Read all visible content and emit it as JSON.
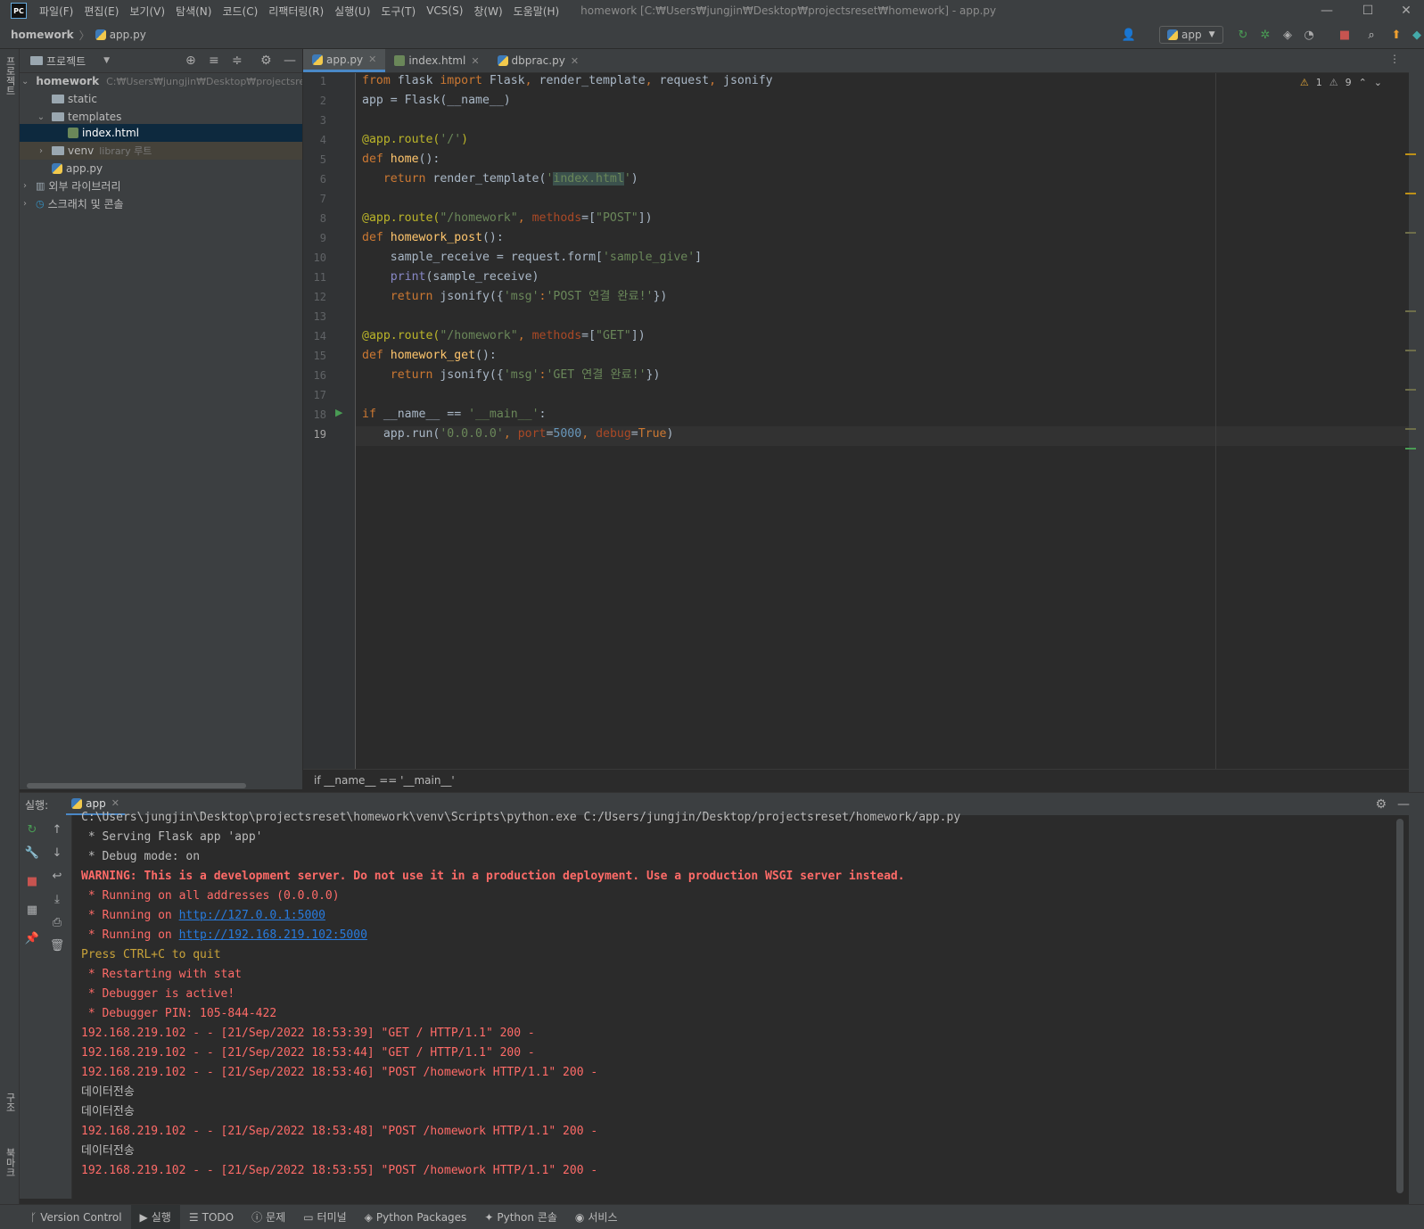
{
  "menubar": {
    "logo": "PC",
    "items": [
      "파일(F)",
      "편집(E)",
      "보기(V)",
      "탐색(N)",
      "코드(C)",
      "리팩터링(R)",
      "실행(U)",
      "도구(T)",
      "VCS(S)",
      "창(W)",
      "도움말(H)"
    ],
    "window_title": "homework [C:₩Users₩jungjin₩Desktop₩projectsreset₩homework] - app.py"
  },
  "navbar": {
    "project": "homework",
    "file": "app.py",
    "run_config": "app"
  },
  "left_stripe": {
    "project_label": "프로젝트",
    "structure_label": "구조",
    "bookmarks_label": "북마크"
  },
  "project_panel": {
    "title": "프로젝트",
    "tree": [
      {
        "label": "homework",
        "hint": "C:₩Users₩jungjin₩Desktop₩projectsres"
      },
      {
        "label": "static"
      },
      {
        "label": "templates"
      },
      {
        "label": "index.html"
      },
      {
        "label": "venv",
        "hint": "library 루트"
      },
      {
        "label": "app.py"
      },
      {
        "label": "외부 라이브러리"
      },
      {
        "label": "스크래치 및 콘솔"
      }
    ]
  },
  "editor": {
    "tabs": [
      {
        "label": "app.py",
        "active": true
      },
      {
        "label": "index.html",
        "active": false
      },
      {
        "label": "dbprac.py",
        "active": false
      }
    ],
    "inspections": {
      "warnings": "1",
      "weak_warnings": "9"
    },
    "line_numbers": [
      "1",
      "2",
      "3",
      "4",
      "5",
      "6",
      "7",
      "8",
      "9",
      "10",
      "11",
      "12",
      "13",
      "14",
      "15",
      "16",
      "17",
      "18",
      "19"
    ],
    "code": {
      "l1": [
        "from",
        " flask ",
        "import",
        " Flask",
        ",",
        " render_template",
        ",",
        " request",
        ",",
        " jsonify"
      ],
      "l2": "app = Flask(__name__)",
      "l4_dec": "@app.route(",
      "l4_str": "'/'",
      "l4_end": ")",
      "l5_kw": "def ",
      "l5_fn": "home",
      "l5_end": "():",
      "l6_kw": "return",
      "l6_mid": " render_template(",
      "l6_q1": "'",
      "l6_str": "index.html",
      "l6_q2": "'",
      "l6_end": ")",
      "l8_dec": "@app.route(",
      "l8_str": "\"/homework\"",
      "l8_comma": ", ",
      "l8_param": "methods",
      "l8_eq": "=[",
      "l8_str2": "\"POST\"",
      "l8_end": "])",
      "l9_kw": "def ",
      "l9_fn": "homework_post",
      "l9_end": "():",
      "l10_a": "    sample_receive = request.form[",
      "l10_str": "'sample_give'",
      "l10_end": "]",
      "l11_bi": "    print",
      "l11_end": "(sample_receive)",
      "l12_kw": "    return",
      "l12_mid": " jsonify({",
      "l12_s1": "'msg'",
      "l12_colon": ":",
      "l12_s2": "'POST 연결 완료!'",
      "l12_end": "})",
      "l14_dec": "@app.route(",
      "l14_str": "\"/homework\"",
      "l14_comma": ", ",
      "l14_param": "methods",
      "l14_eq": "=[",
      "l14_str2": "\"GET\"",
      "l14_end": "])",
      "l15_kw": "def ",
      "l15_fn": "homework_get",
      "l15_end": "():",
      "l16_kw": "    return",
      "l16_mid": " jsonify({",
      "l16_s1": "'msg'",
      "l16_colon": ":",
      "l16_s2": "'GET 연결 완료!'",
      "l16_end": "})",
      "l18_kw": "if",
      "l18_mid": " __name__ == ",
      "l18_str": "'__main__'",
      "l18_end": ":",
      "l19_a": "   app.run(",
      "l19_str": "'0.0.0.0'",
      "l19_c1": ", ",
      "l19_p1": "port",
      "l19_eq1": "=",
      "l19_n": "5000",
      "l19_c2": ", ",
      "l19_p2": "debug",
      "l19_eq2": "=",
      "l19_kw": "True",
      "l19_end": ")"
    },
    "breadcrumb": "if __name__ == '__main__'"
  },
  "run_panel": {
    "label": "실행:",
    "tab": "app",
    "lines": [
      {
        "text": "C:\\Users\\jungjin\\Desktop\\projectsreset\\homework\\venv\\Scripts\\python.exe C:/Users/jungjin/Desktop/projectsreset/homework/app.py",
        "style": "normal"
      },
      {
        "text": " * Serving Flask app 'app'",
        "style": "normal"
      },
      {
        "text": " * Debug mode: on",
        "style": "normal"
      },
      {
        "text": "WARNING: This is a development server. Do not use it in a production deployment. Use a production WSGI server instead.",
        "style": "red-bold"
      },
      {
        "text": " * Running on all addresses (0.0.0.0)",
        "style": "red"
      },
      {
        "prefix": " * Running on ",
        "link": "http://127.0.0.1:5000",
        "style": "link"
      },
      {
        "prefix": " * Running on ",
        "link": "http://192.168.219.102:5000",
        "style": "link"
      },
      {
        "text": "Press CTRL+C to quit",
        "style": "yellow"
      },
      {
        "text": " * Restarting with stat",
        "style": "red"
      },
      {
        "text": " * Debugger is active!",
        "style": "red"
      },
      {
        "text": " * Debugger PIN: 105-844-422",
        "style": "red"
      },
      {
        "text": "192.168.219.102 - - [21/Sep/2022 18:53:39] \"GET / HTTP/1.1\" 200 -",
        "style": "red"
      },
      {
        "text": "192.168.219.102 - - [21/Sep/2022 18:53:44] \"GET / HTTP/1.1\" 200 -",
        "style": "red"
      },
      {
        "text": "192.168.219.102 - - [21/Sep/2022 18:53:46] \"POST /homework HTTP/1.1\" 200 -",
        "style": "red"
      },
      {
        "text": "데이터전송",
        "style": "normal"
      },
      {
        "text": "데이터전송",
        "style": "normal"
      },
      {
        "text": "192.168.219.102 - - [21/Sep/2022 18:53:48] \"POST /homework HTTP/1.1\" 200 -",
        "style": "red"
      },
      {
        "text": "데이터전송",
        "style": "normal"
      },
      {
        "text": "192.168.219.102 - - [21/Sep/2022 18:53:55] \"POST /homework HTTP/1.1\" 200 -",
        "style": "red"
      }
    ]
  },
  "bottom_tools": [
    {
      "label": "Version Control",
      "icon": "branch-icon"
    },
    {
      "label": "실행",
      "icon": "play-icon",
      "active": true
    },
    {
      "label": "TODO",
      "icon": "list-icon"
    },
    {
      "label": "문제",
      "icon": "info-icon"
    },
    {
      "label": "터미널",
      "icon": "terminal-icon"
    },
    {
      "label": "Python Packages",
      "icon": "layers-icon"
    },
    {
      "label": "Python 콘솔",
      "icon": "python-icon"
    },
    {
      "label": "서비스",
      "icon": "services-icon"
    }
  ],
  "colors": {
    "accent": "#4a88c7",
    "selection": "#0d293e",
    "error": "#ff6b68"
  }
}
